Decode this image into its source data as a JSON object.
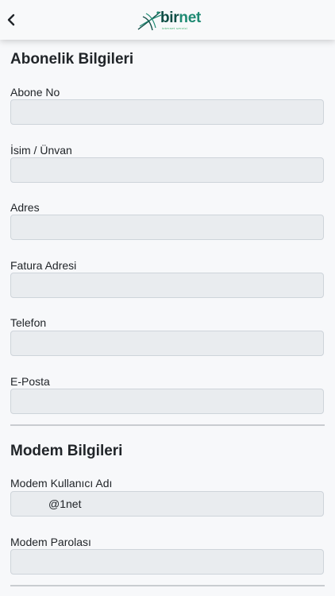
{
  "header": {
    "back_icon": "chevron-left-icon",
    "logo_part1": "bir",
    "logo_part2": "net",
    "logo_tagline": "internet servisi"
  },
  "subscription": {
    "title": "Abonelik Bilgileri",
    "fields": [
      {
        "label": "Abone No",
        "value": ""
      },
      {
        "label": "İsim / Ünvan",
        "value": ""
      },
      {
        "label": "Adres",
        "value": ""
      },
      {
        "label": "Fatura Adresi",
        "value": ""
      },
      {
        "label": "Telefon",
        "value": ""
      },
      {
        "label": "E-Posta",
        "value": ""
      }
    ]
  },
  "modem": {
    "title": "Modem Bilgileri",
    "fields": [
      {
        "label": "Modem Kullanıcı Adı",
        "value": "         @1net"
      },
      {
        "label": "Modem Parolası",
        "value": ""
      }
    ]
  },
  "colors": {
    "input_bg": "#e9ecef",
    "logo_dark": "#0f4d45",
    "logo_accent": "#1f8a73"
  }
}
